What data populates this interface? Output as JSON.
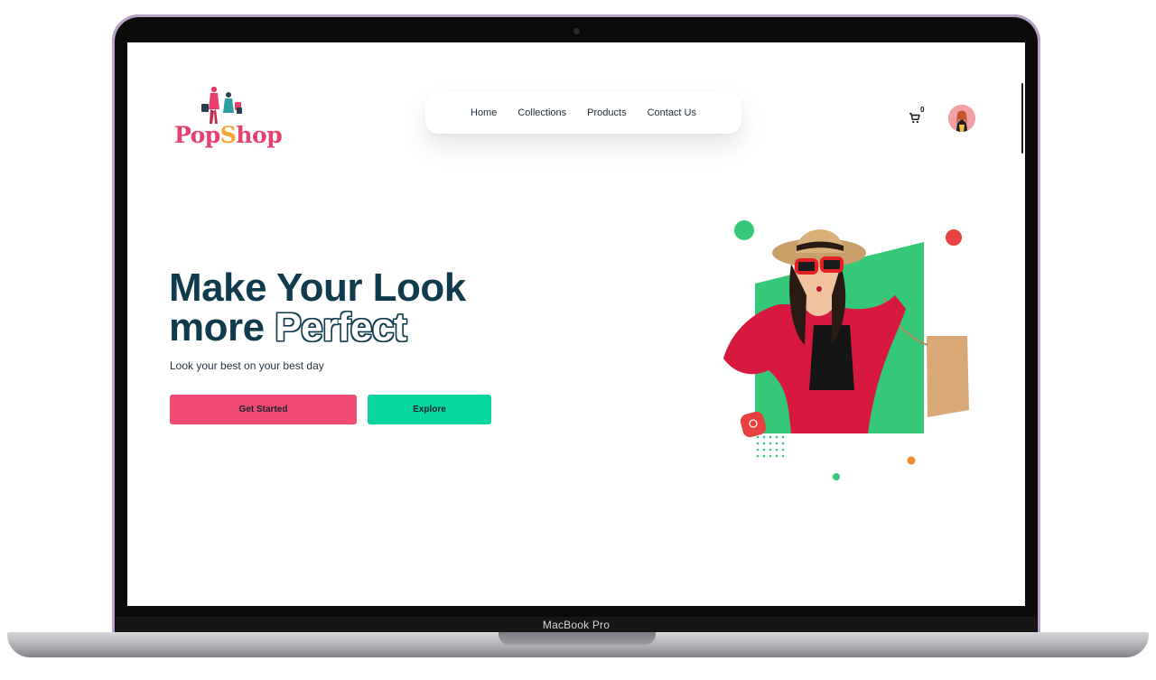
{
  "device": {
    "label": "MacBook Pro"
  },
  "brand": {
    "part1": "Pop",
    "part2_s": "S",
    "part2_rest": "hop"
  },
  "nav": {
    "items": [
      {
        "label": "Home"
      },
      {
        "label": "Collections"
      },
      {
        "label": "Products"
      },
      {
        "label": "Contact Us"
      }
    ]
  },
  "cart": {
    "count": "0",
    "icon": "cart-icon"
  },
  "hero": {
    "line1": "Make Your Look",
    "line2_plain": "more",
    "line2_outline": "Perfect",
    "subtitle": "Look your best on your best day",
    "primary_button": "Get Started",
    "secondary_button": "Explore"
  },
  "colors": {
    "primary": "#f04b72",
    "secondary": "#07d6a0",
    "heading": "#0f3b4c",
    "accent_green": "#35c878",
    "accent_red": "#e8413f",
    "accent_orange": "#f28a2e"
  }
}
